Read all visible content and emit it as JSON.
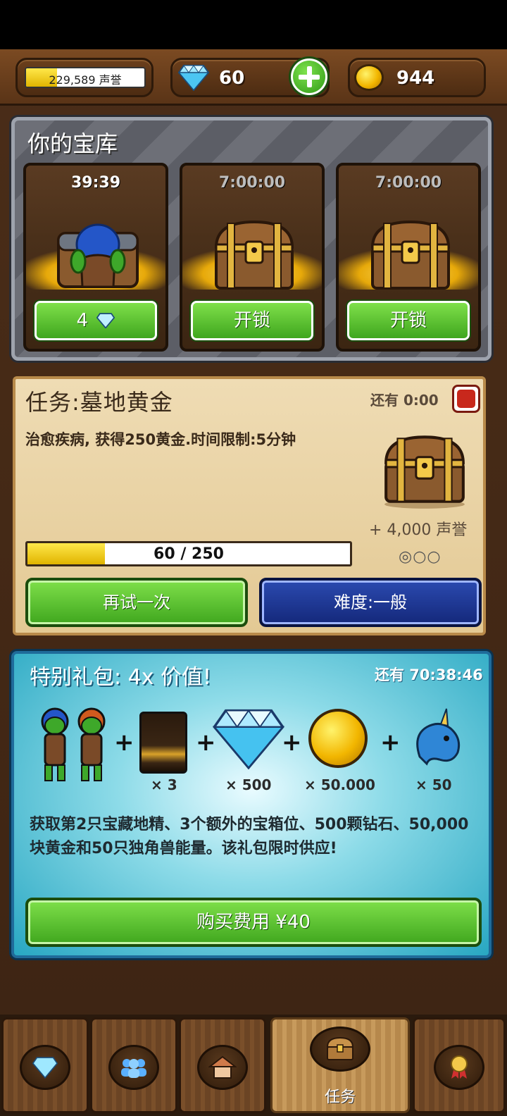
{
  "top_bar": {
    "reputation_text": "229,589 声誉",
    "reputation_fill": 0.26,
    "gems": "60",
    "gold": "944"
  },
  "vault": {
    "title": "你的宝库",
    "slots": [
      {
        "timer": "39:39",
        "button": "4",
        "state": "occupied"
      },
      {
        "timer": "7:00:00",
        "button": "开锁",
        "state": "locked"
      },
      {
        "timer": "7:00:00",
        "button": "开锁",
        "state": "locked"
      }
    ]
  },
  "mission": {
    "title": "任务:墓地黄金",
    "time_left": "还有 0:00",
    "description": "治愈疾病, 获得250黄金.时间限制:5分钟",
    "progress_text": "60 / 250",
    "progress_value": 60,
    "progress_max": 250,
    "reward": "+ 4,000 声誉",
    "stars": "◎○○",
    "retry_label": "再试一次",
    "difficulty_label": "难度:一般"
  },
  "offer": {
    "title": "特别礼包: 4x 价值!",
    "timer": "还有 70:38:46",
    "items": [
      {
        "icon": "goblins",
        "count": ""
      },
      {
        "icon": "chest-card",
        "count": "× 3"
      },
      {
        "icon": "diamond",
        "count": "× 500"
      },
      {
        "icon": "gold-coin",
        "count": "× 50.000"
      },
      {
        "icon": "unicorn",
        "count": "× 50"
      }
    ],
    "description": "获取第2只宝藏地精、3个额外的宝箱位、500颗钻石、50,000块黄金和50只独角兽能量。该礼包限时供应!",
    "buy_label": "购买费用 ¥40"
  },
  "nav": {
    "tabs": [
      {
        "icon": "diamond-icon",
        "label": ""
      },
      {
        "icon": "people-icon",
        "label": ""
      },
      {
        "icon": "house-icon",
        "label": ""
      },
      {
        "icon": "chest-icon",
        "label": "任务",
        "active": true
      },
      {
        "icon": "medal-icon",
        "label": ""
      }
    ]
  }
}
